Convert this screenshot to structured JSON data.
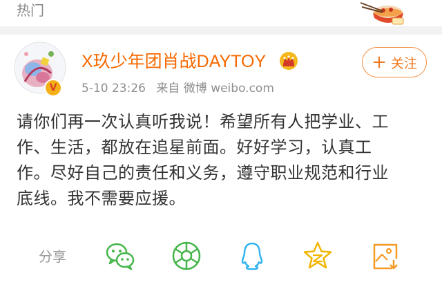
{
  "header": {
    "section_label": "热门"
  },
  "post": {
    "username": "X玖少年团肖战DAYTOY",
    "verified_mark": "V",
    "timestamp": "5-10 23:26",
    "source": "来自 微博 weibo.com",
    "follow_label": "关注",
    "follow_plus": "+",
    "text": "请你们再一次认真听我说！希望所有人把学业、工\n作、生活，都放在追星前面。好好学习，认真工\n作。尽好自己的责任和义务，遵守职业规范和行业\n底线。我不需要应援。"
  },
  "share_bar": {
    "label": "分享",
    "items": [
      "wechat-icon",
      "moments-icon",
      "qq-icon",
      "qzone-icon",
      "save-image-icon"
    ]
  },
  "colors": {
    "brand_orange": "#f86800",
    "follow_orange": "#f07a22",
    "share_green": "#44b549",
    "share_blue": "#33b4f0",
    "share_yellow": "#f2b600",
    "share_orange": "#f59a23",
    "meta_gray": "#8e8e8e",
    "text": "#333333"
  }
}
